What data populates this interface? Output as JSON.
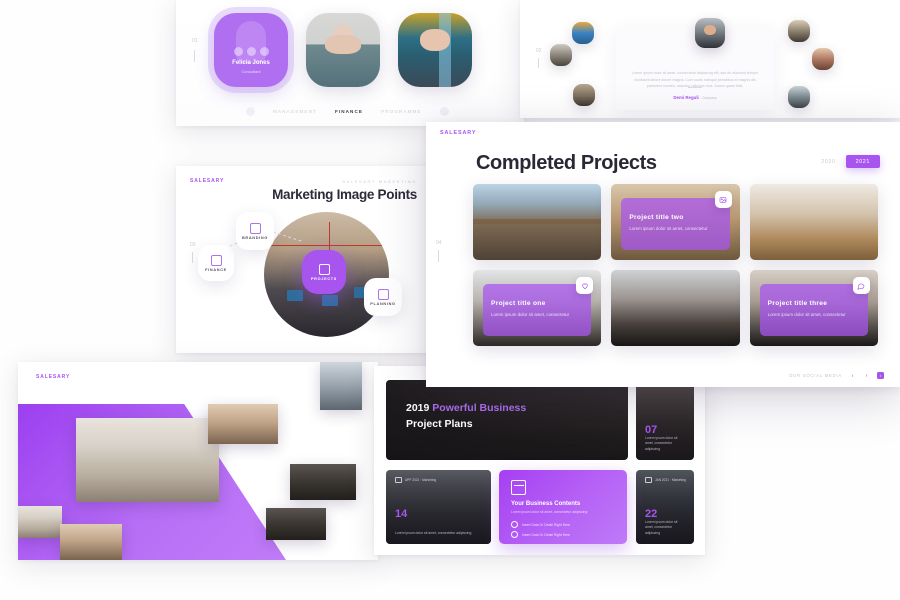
{
  "brand": {
    "name": "SALESARY",
    "accent": "#a855f0",
    "dark": "#2b2734"
  },
  "slide_team": {
    "rail_number": "01",
    "featured": {
      "name": "Felicia Jones",
      "role": "Consultant"
    },
    "nav": {
      "prev": "‹",
      "next": "›",
      "items": [
        {
          "label": "MANAGEMENT",
          "active": false
        },
        {
          "label": "FINANCE",
          "active": true
        },
        {
          "label": "PROGRAMME",
          "active": false
        }
      ]
    }
  },
  "slide_testimonial": {
    "rail_number": "02",
    "quote": "Lorem ipsum dolor sit amet, consectetur adipiscing elit, sed do eiusmod tempor incididunt labore dolore magna. Cum sociis natoque penatibus et magnis dis parturient montes, nascetur ridiculus mus. Donec quam felis.",
    "author_name": "Demi Reguli",
    "author_company": "- Company"
  },
  "slide_marketing": {
    "rail_number": "03",
    "eyebrow": "SALESARY MARKETING",
    "title": "Marketing Image Points",
    "nodes": [
      {
        "label": "FINANCE",
        "active": false,
        "icon": "card-icon"
      },
      {
        "label": "BRANDING",
        "active": false,
        "icon": "database-icon"
      },
      {
        "label": "PROJECTS",
        "active": true,
        "icon": "file-icon"
      },
      {
        "label": "PLANNING",
        "active": false,
        "icon": "monitor-icon"
      }
    ]
  },
  "slide_gallery": {
    "logo": "SALESARY"
  },
  "slide_plans": {
    "hero": {
      "year": "2019",
      "highlight": "Powerful Business",
      "line2": "Project Plans"
    },
    "cards": [
      {
        "number": "07",
        "tag": "",
        "text": "Lorem ipsum dolor sit amet, consectetur adipiscing"
      },
      {
        "number": "14",
        "tag": "APP 2021  ·  Marketing",
        "text": "Lorem ipsum dolor sit amet, consectetur adipiscing"
      },
      {
        "number": "22",
        "tag": "JAN 2021  ·  Marketing",
        "text": "Lorem ipsum dolor sit amet, consectetur adipiscing"
      }
    ],
    "mid": {
      "title": "Your Business Contents",
      "desc": "Lorem ipsum dolor sit amet, consectetur adipiscing",
      "bullets": [
        "Insert Data Or Detail Right Here",
        "Insert Data Or Detail Right Here"
      ]
    }
  },
  "slide_main": {
    "logo": "SALESARY",
    "title": "Completed Projects",
    "rail_number": "04",
    "years": [
      {
        "label": "2020",
        "active": false
      },
      {
        "label": "2021",
        "active": true
      }
    ],
    "projects": [
      {
        "title": "",
        "desc": "",
        "overlay": false,
        "icon": "",
        "bg": "bg-a"
      },
      {
        "title": "Project title two",
        "desc": "Lorem ipsum dolor sit amet, consectetur",
        "overlay": true,
        "icon": "image-icon",
        "bg": "bg-b"
      },
      {
        "title": "",
        "desc": "",
        "overlay": false,
        "icon": "",
        "bg": "bg-c"
      },
      {
        "title": "Project title one",
        "desc": "Lorem ipsum dolor sit amet, consectetur",
        "overlay": true,
        "icon": "heart-icon",
        "bg": "bg-d"
      },
      {
        "title": "",
        "desc": "",
        "overlay": false,
        "icon": "",
        "bg": "bg-e"
      },
      {
        "title": "Project title three",
        "desc": "Lorem ipsum dolor sit amet, consectetur",
        "overlay": true,
        "icon": "chat-icon",
        "bg": "bg-f"
      }
    ],
    "footer": {
      "label": "OUR SOCIAL MEDIA",
      "socials": [
        "twitter-icon",
        "facebook-icon",
        "instagram-icon"
      ]
    }
  }
}
